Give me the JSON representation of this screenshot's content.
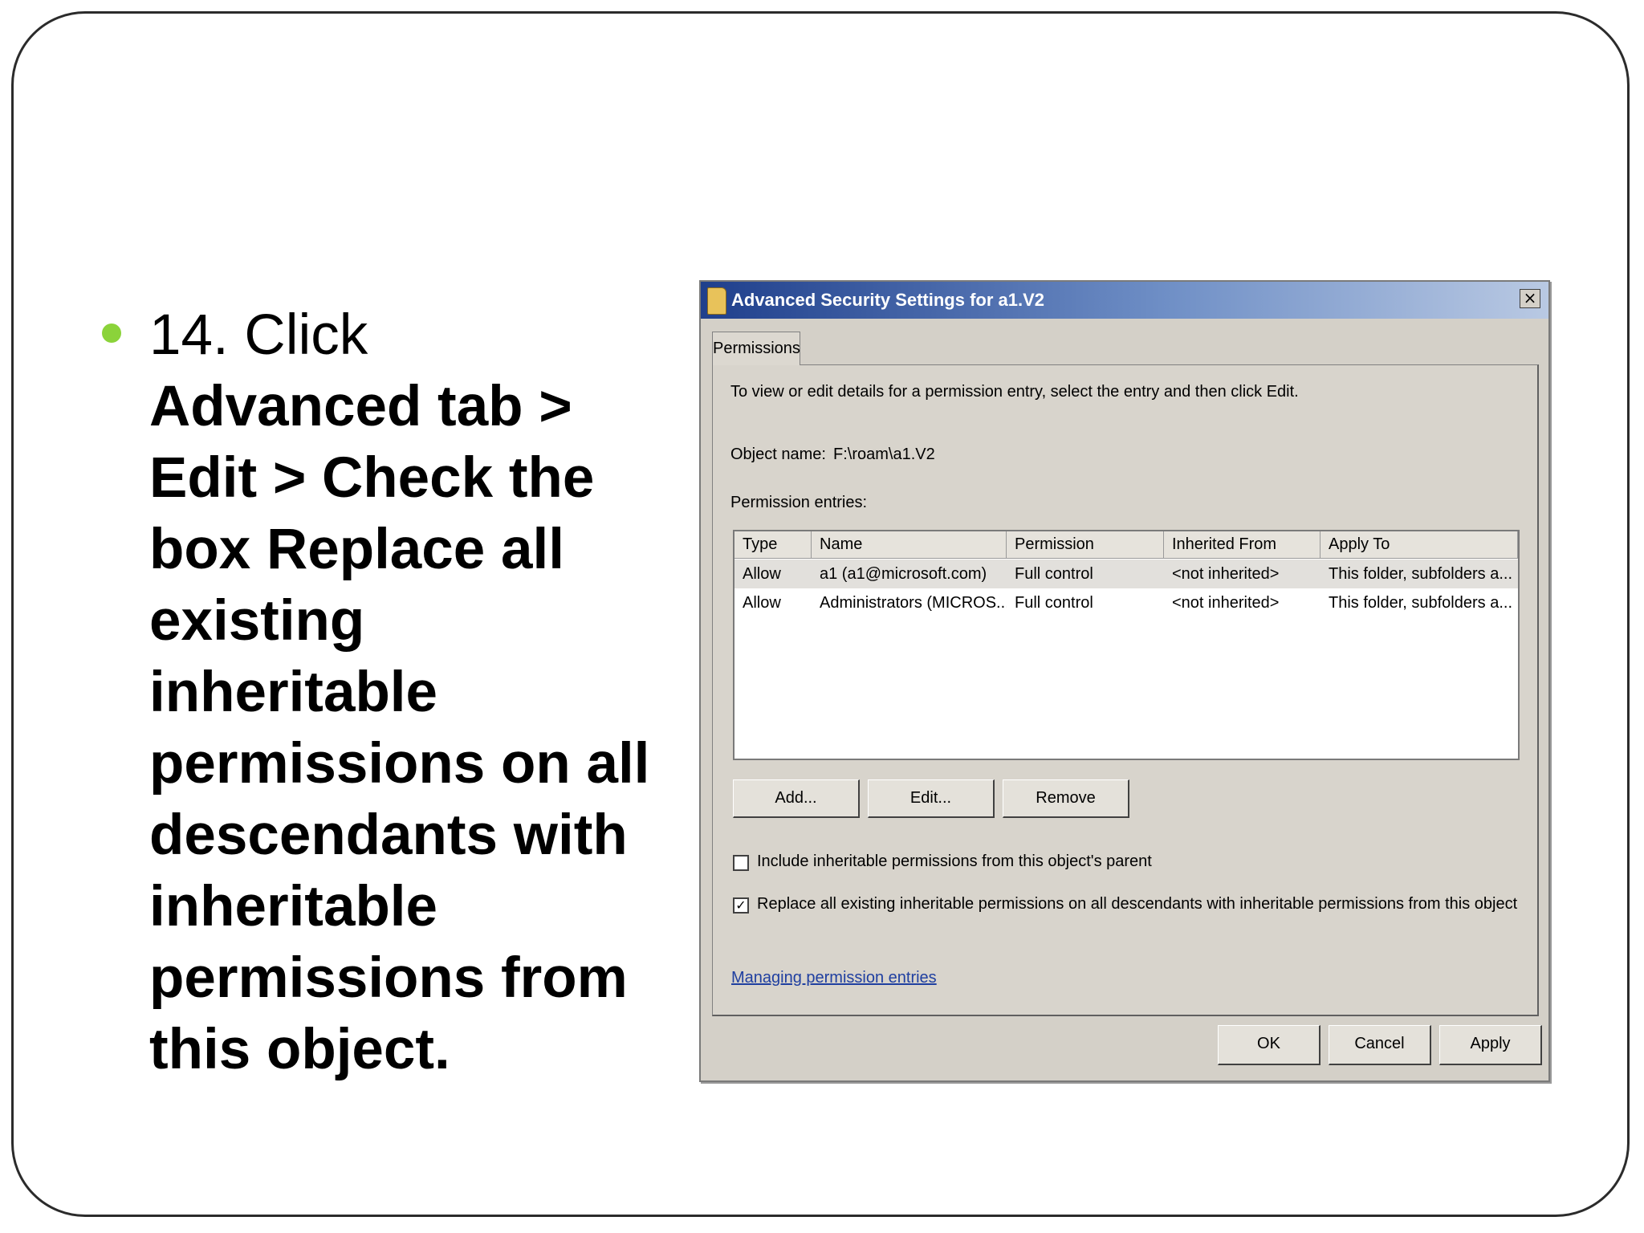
{
  "colors": {
    "bullet": "#8bd33a",
    "title_bar_start": "#1f3f8c",
    "link": "#1f3fa0"
  },
  "slide": {
    "bullet_lead": "14. Click",
    "bullet_body": "Advanced tab  > Edit  > Check the box Replace all existing inheritable permissions on all descendants with inheritable permissions from this object."
  },
  "dialog": {
    "title": "Advanced Security Settings for a1.V2",
    "close_glyph": "×",
    "icon": "folder-icon",
    "tab_label": "Permissions",
    "instructions": "To view or edit details for a permission entry, select the entry and then click Edit.",
    "object_name_label": "Object name:",
    "object_name_value": "F:\\roam\\a1.V2",
    "entries_label": "Permission entries:",
    "columns": [
      "Type",
      "Name",
      "Permission",
      "Inherited From",
      "Apply To"
    ],
    "rows": [
      [
        "Allow",
        "a1 (a1@microsoft.com)",
        "Full control",
        "<not inherited>",
        "This folder, subfolders a..."
      ],
      [
        "Allow",
        "Administrators (MICROS...",
        "Full control",
        "<not inherited>",
        "This folder, subfolders a..."
      ]
    ],
    "add_button": "Add...",
    "edit_button": "Edit...",
    "remove_button": "Remove",
    "include_checkbox_label": "Include inheritable permissions from this object's parent",
    "include_checked": false,
    "replace_checkbox_label": "Replace all existing inheritable permissions on all descendants with inheritable permissions from this object",
    "replace_checked": true,
    "check_glyph": "✓",
    "help_link": "Managing permission entries",
    "ok_button": "OK",
    "cancel_button": "Cancel",
    "apply_button": "Apply"
  }
}
